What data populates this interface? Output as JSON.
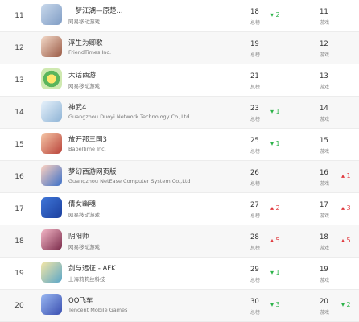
{
  "colors": {
    "up": "#2db34a",
    "down": "#e0393e"
  },
  "rows": [
    {
      "rank": "11",
      "name": "一梦江湖—原楚...",
      "publisher": "网易移动游戏",
      "total_rank": "18",
      "total_label": "总榜",
      "total_change": "2",
      "total_dir": "up",
      "game_rank": "11",
      "game_label": "游戏",
      "game_change": "",
      "game_dir": "none",
      "icon": "chu-liuxiang-app-icon"
    },
    {
      "rank": "12",
      "name": "浮生为卿歌",
      "publisher": "FriendTimes Inc.",
      "total_rank": "19",
      "total_label": "总榜",
      "total_change": "",
      "total_dir": "none",
      "game_rank": "12",
      "game_label": "游戏",
      "game_change": "",
      "game_dir": "none",
      "icon": "fushengweiqingge-app-icon"
    },
    {
      "rank": "13",
      "name": "大话西游",
      "publisher": "网易移动游戏",
      "total_rank": "21",
      "total_label": "总榜",
      "total_change": "",
      "total_dir": "none",
      "game_rank": "13",
      "game_label": "游戏",
      "game_change": "",
      "game_dir": "none",
      "icon": "dahuaxiyou-app-icon"
    },
    {
      "rank": "14",
      "name": "神武4",
      "publisher": "Guangzhou Duoyi Network Technology Co.,Ltd.",
      "total_rank": "23",
      "total_label": "总榜",
      "total_change": "1",
      "total_dir": "up",
      "game_rank": "14",
      "game_label": "游戏",
      "game_change": "",
      "game_dir": "none",
      "icon": "shenwu4-app-icon"
    },
    {
      "rank": "15",
      "name": "放开那三国3",
      "publisher": "Babeltime Inc.",
      "total_rank": "25",
      "total_label": "总榜",
      "total_change": "1",
      "total_dir": "up",
      "game_rank": "15",
      "game_label": "游戏",
      "game_change": "",
      "game_dir": "none",
      "icon": "fangkai-nasanguo3-app-icon"
    },
    {
      "rank": "16",
      "name": "梦幻西游网页版",
      "publisher": "Guangzhou NetEase Computer System Co.,Ltd",
      "total_rank": "26",
      "total_label": "总榜",
      "total_change": "",
      "total_dir": "none",
      "game_rank": "16",
      "game_label": "游戏",
      "game_change": "1",
      "game_dir": "down",
      "icon": "menghuan-xiyou-web-app-icon"
    },
    {
      "rank": "17",
      "name": "倩女幽魂",
      "publisher": "网易移动游戏",
      "total_rank": "27",
      "total_label": "总榜",
      "total_change": "2",
      "total_dir": "down",
      "game_rank": "17",
      "game_label": "游戏",
      "game_change": "3",
      "game_dir": "down",
      "icon": "qiannv-youhun-app-icon"
    },
    {
      "rank": "18",
      "name": "阴阳师",
      "publisher": "网易移动游戏",
      "total_rank": "28",
      "total_label": "总榜",
      "total_change": "5",
      "total_dir": "down",
      "game_rank": "18",
      "game_label": "游戏",
      "game_change": "5",
      "game_dir": "down",
      "icon": "yinyangshi-app-icon"
    },
    {
      "rank": "19",
      "name": "剑与远征 - AFK",
      "publisher": "上海莉莉丝科技",
      "total_rank": "29",
      "total_label": "总榜",
      "total_change": "1",
      "total_dir": "up",
      "game_rank": "19",
      "game_label": "游戏",
      "game_change": "",
      "game_dir": "none",
      "icon": "afk-arena-app-icon"
    },
    {
      "rank": "20",
      "name": "QQ飞车",
      "publisher": "Tencent Mobile Games",
      "total_rank": "30",
      "total_label": "总榜",
      "total_change": "3",
      "total_dir": "up",
      "game_rank": "20",
      "game_label": "游戏",
      "game_change": "2",
      "game_dir": "up",
      "icon": "qq-speed-app-icon"
    }
  ]
}
